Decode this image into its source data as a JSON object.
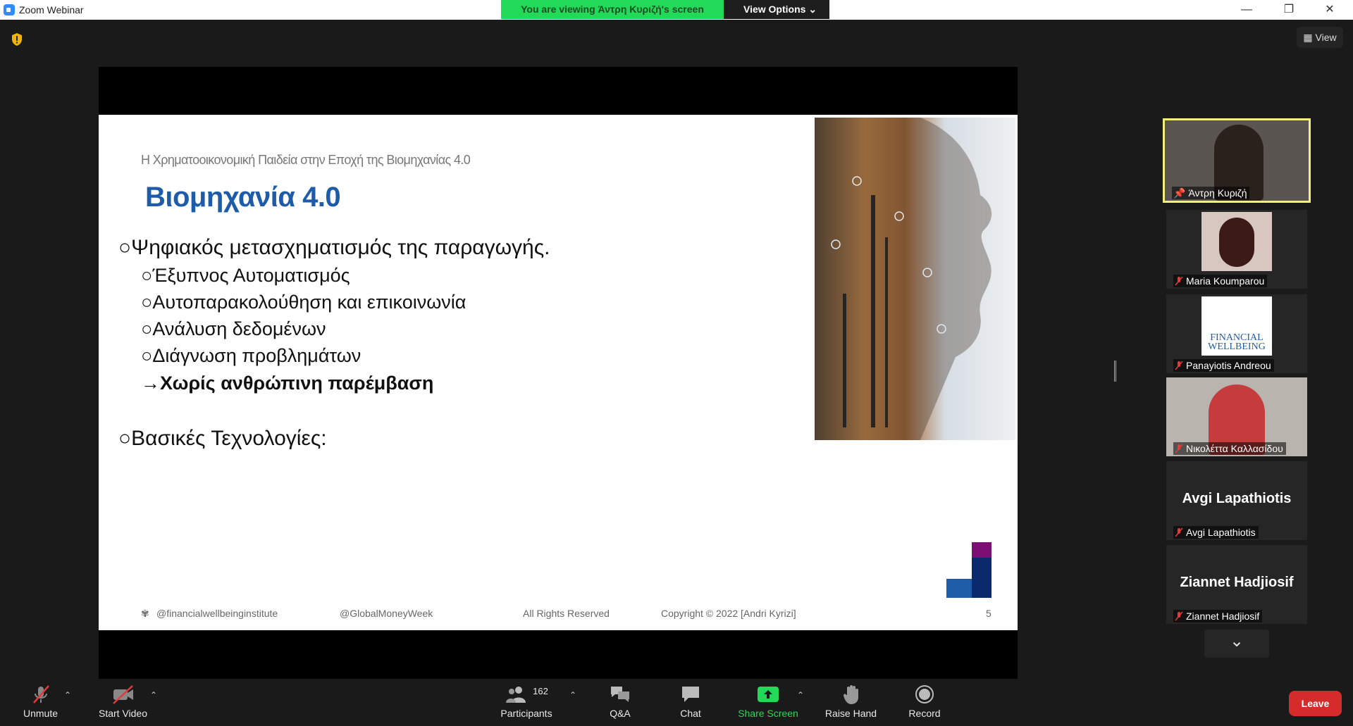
{
  "window": {
    "title": "Zoom Webinar",
    "minimize": "—",
    "restore": "❐",
    "close": "✕"
  },
  "banner": {
    "viewing": "You are viewing Άντρη Κυριζή's screen",
    "view_options": "View Options"
  },
  "view_button": "View",
  "slide": {
    "subtitle": "Η Χρηματοοικονομική Παιδεία στην Εποχή της Βιομηχανίας 4.0",
    "heading": "Βιομηχανία 4.0",
    "bullets": [
      "Ψηφιακός μετασχηματισμός της παραγωγής.",
      "Βασικές Τεχνολογίες:"
    ],
    "sub_bullets": [
      "Έξυπνος Αυτοματισμός",
      "Αυτοπαρακολούθηση και επικοινωνία",
      "Ανάλυση δεδομένων",
      "Διάγνωση προβλημάτων"
    ],
    "arrow_item": "→Χωρίς ανθρώπινη παρέμβαση",
    "footer": {
      "instagram": "@financialwellbeinginstitute",
      "campaign": "@GlobalMoneyWeek",
      "rights": "All Rights Reserved",
      "copyright": "Copyright © 2022 [Andri Kyrizi]",
      "page": "5"
    },
    "colors": {
      "heading": "#1f5ca8",
      "logo_purple": "#7b0f73",
      "logo_navy": "#0b2a6e",
      "logo_blue": "#1f5ca8"
    }
  },
  "gallery": {
    "participants": [
      {
        "name": "Άντρη Κυριζή",
        "pinned": true,
        "video": true
      },
      {
        "name": "Maria Koumparou",
        "muted": true,
        "video": true
      },
      {
        "name": "Panayiotis Andreou",
        "muted": true,
        "video": true,
        "thumb_text": "FINANCIAL WELLBEING"
      },
      {
        "name": "Νικολέττα Καλλασίδου",
        "muted": true,
        "video": true
      },
      {
        "name": "Avgi Lapathiotis",
        "muted": true,
        "big_name": "Avgi Lapathiotis"
      },
      {
        "name": "Ziannet Hadjiosif",
        "muted": true,
        "big_name": "Ziannet Hadjiosif"
      }
    ],
    "more": "⌄"
  },
  "toolbar": {
    "unmute": "Unmute",
    "start_video": "Start Video",
    "participants": "Participants",
    "participants_count": "162",
    "qa": "Q&A",
    "chat": "Chat",
    "share_screen": "Share Screen",
    "raise_hand": "Raise Hand",
    "record": "Record",
    "leave": "Leave",
    "accent": "#23d959"
  }
}
